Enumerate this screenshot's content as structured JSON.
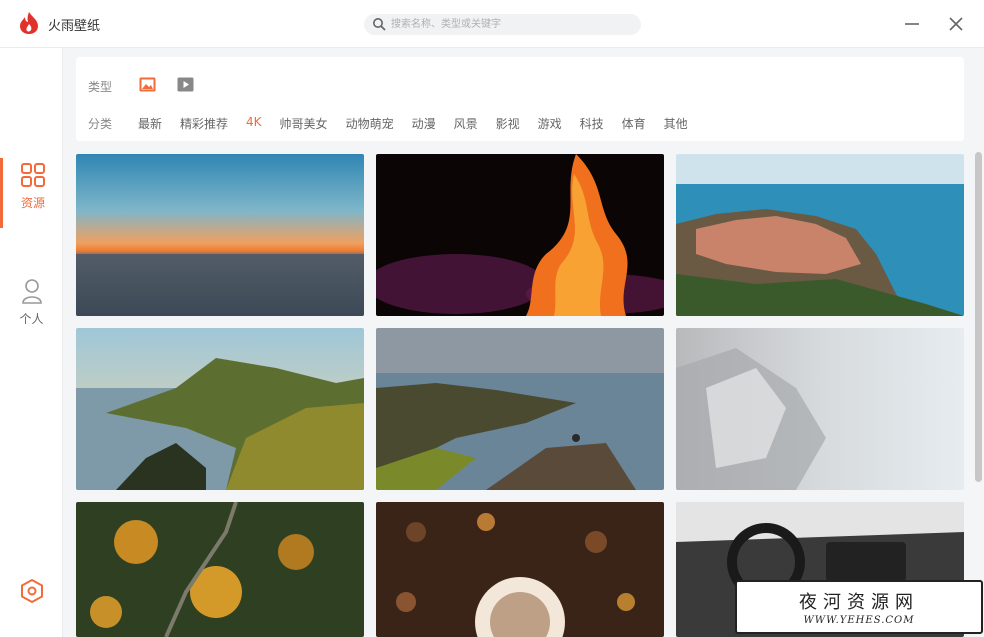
{
  "app": {
    "title": "火雨壁纸"
  },
  "search": {
    "placeholder": "搜索名称、类型或关键字"
  },
  "sidebar": {
    "items": [
      {
        "label": "资源",
        "icon": "grid-icon",
        "active": true
      },
      {
        "label": "个人",
        "icon": "user-icon",
        "active": false
      }
    ],
    "settings_icon": "hexagon-settings-icon"
  },
  "filters": {
    "type_label": "类型",
    "types": [
      {
        "icon": "image-icon",
        "active": true
      },
      {
        "icon": "video-icon",
        "active": false
      }
    ],
    "category_label": "分类",
    "categories": [
      {
        "label": "最新",
        "active": false
      },
      {
        "label": "精彩推荐",
        "active": false
      },
      {
        "label": "4K",
        "active": true
      },
      {
        "label": "帅哥美女",
        "active": false
      },
      {
        "label": "动物萌宠",
        "active": false
      },
      {
        "label": "动漫",
        "active": false
      },
      {
        "label": "风景",
        "active": false
      },
      {
        "label": "影视",
        "active": false
      },
      {
        "label": "游戏",
        "active": false
      },
      {
        "label": "科技",
        "active": false
      },
      {
        "label": "体育",
        "active": false
      },
      {
        "label": "其他",
        "active": false
      }
    ]
  },
  "wallpapers": [
    "sunset-sea",
    "fire-smoke",
    "cliff-village",
    "coastal-cliffs",
    "hiker-fjord",
    "frost-crystals",
    "autumn-forest",
    "coffee-beans",
    "car-interior"
  ],
  "colors": {
    "accent": "#f26b3a"
  },
  "watermark": {
    "text": "夜河资源网",
    "url": "WWW.YEHES.COM"
  }
}
